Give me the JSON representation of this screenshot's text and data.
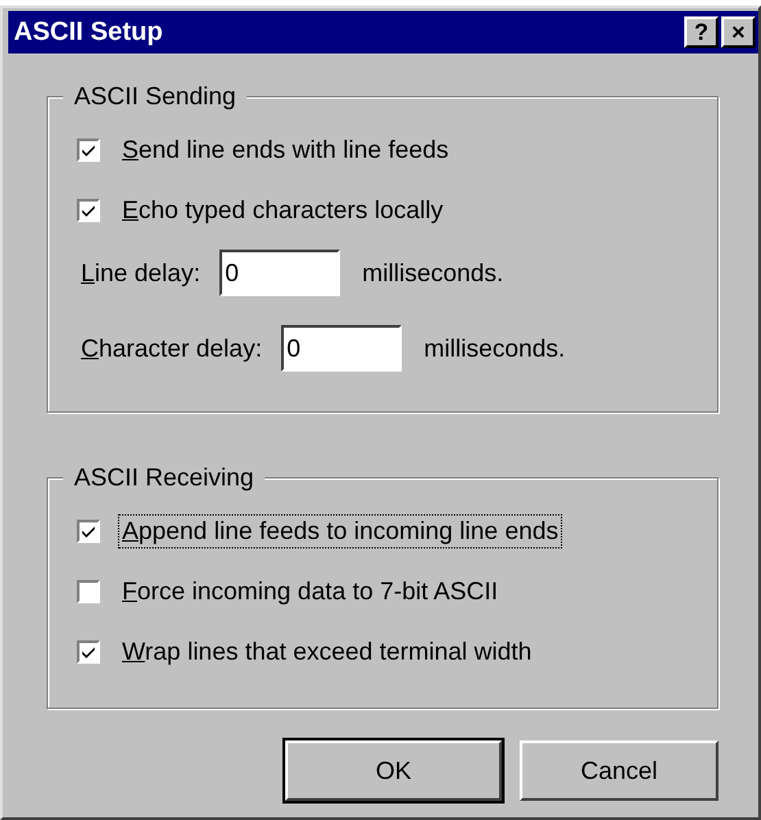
{
  "window": {
    "title": "ASCII Setup",
    "title_buttons": [
      "?",
      "×"
    ]
  },
  "groups": [
    {
      "title": "ASCII Sending",
      "items": [
        {
          "kind": "checkbox",
          "label": "Send line ends with line feeds",
          "checked": true,
          "focused": false
        },
        {
          "kind": "checkbox",
          "label": "Echo typed characters locally",
          "checked": true,
          "focused": false
        },
        {
          "kind": "field",
          "label": "Line delay:",
          "value": "0",
          "unit": "milliseconds."
        },
        {
          "kind": "field",
          "label": "Character delay:",
          "value": "0",
          "unit": "milliseconds."
        }
      ]
    },
    {
      "title": "ASCII Receiving",
      "items": [
        {
          "kind": "checkbox",
          "label": "Append line feeds to incoming line ends",
          "checked": true,
          "focused": true
        },
        {
          "kind": "checkbox",
          "label": "Force incoming data to 7-bit ASCII",
          "checked": false,
          "focused": false
        },
        {
          "kind": "checkbox",
          "label": "Wrap lines that exceed terminal width",
          "checked": true,
          "focused": false
        }
      ]
    }
  ],
  "buttons": [
    {
      "label": "OK",
      "default": true
    },
    {
      "label": "Cancel",
      "default": false
    }
  ]
}
